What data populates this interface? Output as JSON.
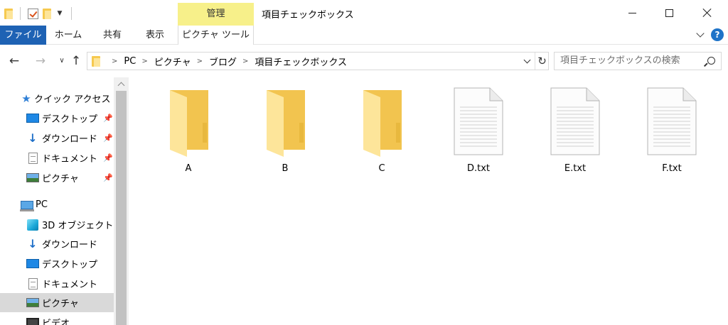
{
  "window": {
    "title": "項目チェックボックス",
    "context_tab_group": "管理"
  },
  "ribbon": {
    "tabs": [
      {
        "label": "ファイル"
      },
      {
        "label": "ホーム"
      },
      {
        "label": "共有"
      },
      {
        "label": "表示"
      },
      {
        "label": "ピクチャ ツール"
      }
    ],
    "help_label": "?"
  },
  "address_bar": {
    "breadcrumbs": [
      "PC",
      "ピクチャ",
      "ブログ",
      "項目チェックボックス"
    ]
  },
  "search": {
    "placeholder": "項目チェックボックスの検索"
  },
  "nav_pane": {
    "quick_access": {
      "label": "クイック アクセス",
      "items": [
        {
          "label": "デスクトップ",
          "icon": "desktop-icon",
          "pinned": true
        },
        {
          "label": "ダウンロード",
          "icon": "download-icon",
          "pinned": true
        },
        {
          "label": "ドキュメント",
          "icon": "document-icon",
          "pinned": true
        },
        {
          "label": "ピクチャ",
          "icon": "pictures-icon",
          "pinned": true
        }
      ]
    },
    "pc": {
      "label": "PC",
      "items": [
        {
          "label": "3D オブジェクト",
          "icon": "3d-objects-icon"
        },
        {
          "label": "ダウンロード",
          "icon": "download-icon"
        },
        {
          "label": "デスクトップ",
          "icon": "desktop-icon"
        },
        {
          "label": "ドキュメント",
          "icon": "document-icon"
        },
        {
          "label": "ピクチャ",
          "icon": "pictures-icon",
          "selected": true
        },
        {
          "label": "ビデオ",
          "icon": "video-icon"
        }
      ]
    }
  },
  "files": [
    {
      "name": "A",
      "type": "folder"
    },
    {
      "name": "B",
      "type": "folder"
    },
    {
      "name": "C",
      "type": "folder"
    },
    {
      "name": "D.txt",
      "type": "text-file"
    },
    {
      "name": "E.txt",
      "type": "text-file"
    },
    {
      "name": "F.txt",
      "type": "text-file"
    }
  ],
  "colors": {
    "file_tab": "#1e62b4",
    "manage_tab": "#f7f08a",
    "selection": "#d9d9d9",
    "folder_back": "#f2c44f",
    "folder_front": "#fde59a"
  }
}
